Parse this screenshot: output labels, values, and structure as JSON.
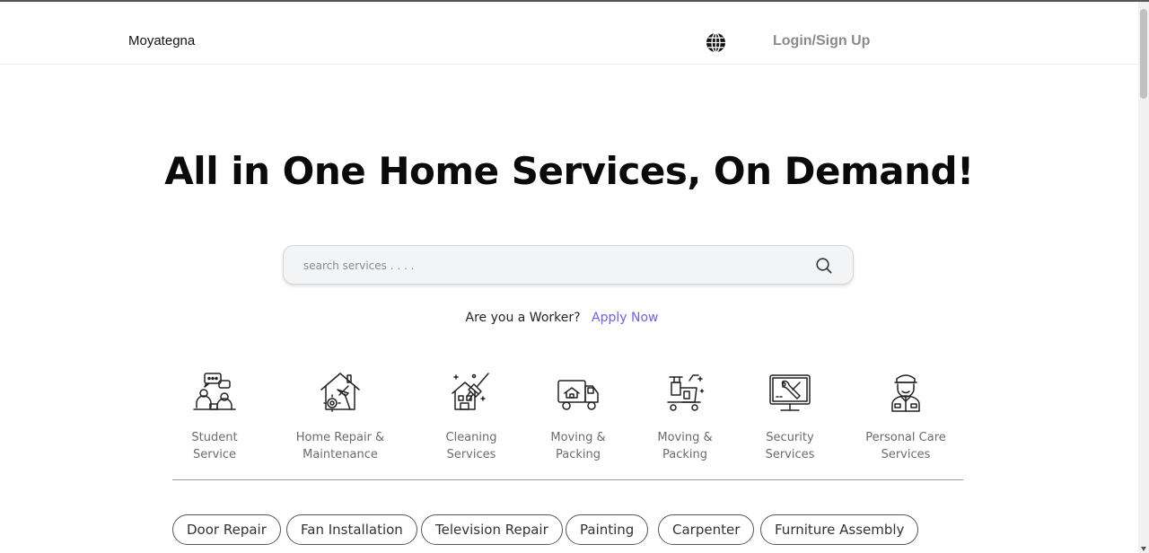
{
  "nav": {
    "brand": "Moyategna",
    "language_icon": "globe-icon",
    "login_label": "Login/Sign Up"
  },
  "hero": {
    "title": "All in One Home Services, On Demand!"
  },
  "search": {
    "placeholder": "search services . . . .",
    "value": "",
    "icon": "search-icon"
  },
  "worker_cta": {
    "question": "Are you a Worker?",
    "link": "Apply Now"
  },
  "categories": [
    {
      "line1": "Student",
      "line2": "Service",
      "icon": "student-service-icon"
    },
    {
      "line1": "Home Repair &",
      "line2": "Maintenance",
      "icon": "house-repair-icon"
    },
    {
      "line1": "Cleaning",
      "line2": "Services",
      "icon": "cleaning-house-icon"
    },
    {
      "line1": "Moving &",
      "line2": "Packing",
      "icon": "moving-truck-icon"
    },
    {
      "line1": "Moving &",
      "line2": "Packing",
      "icon": "cleaning-cart-icon"
    },
    {
      "line1": "Security",
      "line2": "Services",
      "icon": "monitor-tools-icon"
    },
    {
      "line1": "Personal Care",
      "line2": "Services",
      "icon": "security-guard-icon"
    }
  ],
  "chips": [
    "Door Repair",
    "Fan Installation",
    "Television Repair",
    "Painting",
    "Carpenter",
    "Furniture Assembly"
  ],
  "colors": {
    "accent": "#6b63e6",
    "login_text": "#8a8a8a",
    "search_bg": "#f3f4f6"
  }
}
